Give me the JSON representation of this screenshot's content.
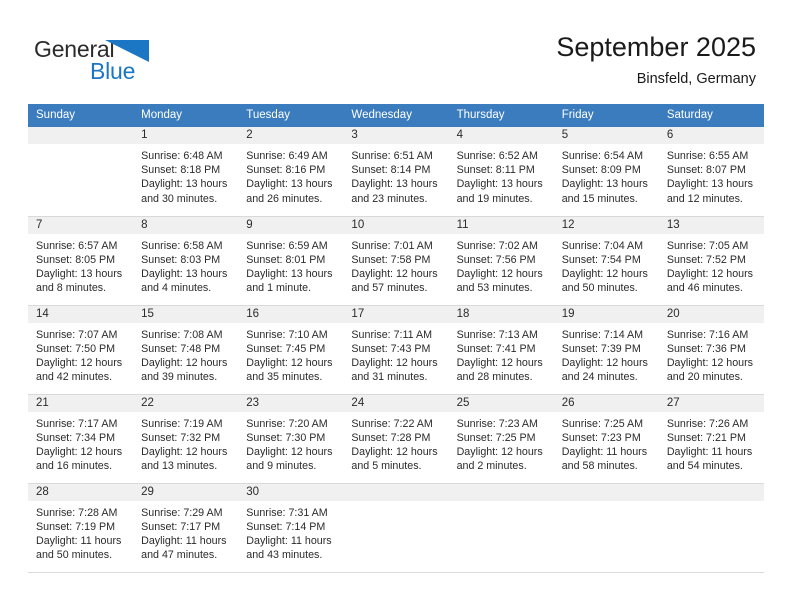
{
  "brand": {
    "name_part1": "General",
    "name_part2": "Blue",
    "accent_color": "#1b76c4",
    "triangle_icon": "triangle-right-icon"
  },
  "header": {
    "title": "September 2025",
    "subtitle": "Binsfeld, Germany",
    "header_bg": "#3b7cbf"
  },
  "calendar": {
    "weekday_headers": [
      "Sunday",
      "Monday",
      "Tuesday",
      "Wednesday",
      "Thursday",
      "Friday",
      "Saturday"
    ],
    "weeks": [
      [
        {
          "day": "",
          "sunrise": "",
          "sunset": "",
          "daylight1": "",
          "daylight2": "",
          "blank": true
        },
        {
          "day": "1",
          "sunrise": "Sunrise: 6:48 AM",
          "sunset": "Sunset: 8:18 PM",
          "daylight1": "Daylight: 13 hours",
          "daylight2": "and 30 minutes."
        },
        {
          "day": "2",
          "sunrise": "Sunrise: 6:49 AM",
          "sunset": "Sunset: 8:16 PM",
          "daylight1": "Daylight: 13 hours",
          "daylight2": "and 26 minutes."
        },
        {
          "day": "3",
          "sunrise": "Sunrise: 6:51 AM",
          "sunset": "Sunset: 8:14 PM",
          "daylight1": "Daylight: 13 hours",
          "daylight2": "and 23 minutes."
        },
        {
          "day": "4",
          "sunrise": "Sunrise: 6:52 AM",
          "sunset": "Sunset: 8:11 PM",
          "daylight1": "Daylight: 13 hours",
          "daylight2": "and 19 minutes."
        },
        {
          "day": "5",
          "sunrise": "Sunrise: 6:54 AM",
          "sunset": "Sunset: 8:09 PM",
          "daylight1": "Daylight: 13 hours",
          "daylight2": "and 15 minutes."
        },
        {
          "day": "6",
          "sunrise": "Sunrise: 6:55 AM",
          "sunset": "Sunset: 8:07 PM",
          "daylight1": "Daylight: 13 hours",
          "daylight2": "and 12 minutes."
        }
      ],
      [
        {
          "day": "7",
          "sunrise": "Sunrise: 6:57 AM",
          "sunset": "Sunset: 8:05 PM",
          "daylight1": "Daylight: 13 hours",
          "daylight2": "and 8 minutes."
        },
        {
          "day": "8",
          "sunrise": "Sunrise: 6:58 AM",
          "sunset": "Sunset: 8:03 PM",
          "daylight1": "Daylight: 13 hours",
          "daylight2": "and 4 minutes."
        },
        {
          "day": "9",
          "sunrise": "Sunrise: 6:59 AM",
          "sunset": "Sunset: 8:01 PM",
          "daylight1": "Daylight: 13 hours",
          "daylight2": "and 1 minute."
        },
        {
          "day": "10",
          "sunrise": "Sunrise: 7:01 AM",
          "sunset": "Sunset: 7:58 PM",
          "daylight1": "Daylight: 12 hours",
          "daylight2": "and 57 minutes."
        },
        {
          "day": "11",
          "sunrise": "Sunrise: 7:02 AM",
          "sunset": "Sunset: 7:56 PM",
          "daylight1": "Daylight: 12 hours",
          "daylight2": "and 53 minutes."
        },
        {
          "day": "12",
          "sunrise": "Sunrise: 7:04 AM",
          "sunset": "Sunset: 7:54 PM",
          "daylight1": "Daylight: 12 hours",
          "daylight2": "and 50 minutes."
        },
        {
          "day": "13",
          "sunrise": "Sunrise: 7:05 AM",
          "sunset": "Sunset: 7:52 PM",
          "daylight1": "Daylight: 12 hours",
          "daylight2": "and 46 minutes."
        }
      ],
      [
        {
          "day": "14",
          "sunrise": "Sunrise: 7:07 AM",
          "sunset": "Sunset: 7:50 PM",
          "daylight1": "Daylight: 12 hours",
          "daylight2": "and 42 minutes."
        },
        {
          "day": "15",
          "sunrise": "Sunrise: 7:08 AM",
          "sunset": "Sunset: 7:48 PM",
          "daylight1": "Daylight: 12 hours",
          "daylight2": "and 39 minutes."
        },
        {
          "day": "16",
          "sunrise": "Sunrise: 7:10 AM",
          "sunset": "Sunset: 7:45 PM",
          "daylight1": "Daylight: 12 hours",
          "daylight2": "and 35 minutes."
        },
        {
          "day": "17",
          "sunrise": "Sunrise: 7:11 AM",
          "sunset": "Sunset: 7:43 PM",
          "daylight1": "Daylight: 12 hours",
          "daylight2": "and 31 minutes."
        },
        {
          "day": "18",
          "sunrise": "Sunrise: 7:13 AM",
          "sunset": "Sunset: 7:41 PM",
          "daylight1": "Daylight: 12 hours",
          "daylight2": "and 28 minutes."
        },
        {
          "day": "19",
          "sunrise": "Sunrise: 7:14 AM",
          "sunset": "Sunset: 7:39 PM",
          "daylight1": "Daylight: 12 hours",
          "daylight2": "and 24 minutes."
        },
        {
          "day": "20",
          "sunrise": "Sunrise: 7:16 AM",
          "sunset": "Sunset: 7:36 PM",
          "daylight1": "Daylight: 12 hours",
          "daylight2": "and 20 minutes."
        }
      ],
      [
        {
          "day": "21",
          "sunrise": "Sunrise: 7:17 AM",
          "sunset": "Sunset: 7:34 PM",
          "daylight1": "Daylight: 12 hours",
          "daylight2": "and 16 minutes."
        },
        {
          "day": "22",
          "sunrise": "Sunrise: 7:19 AM",
          "sunset": "Sunset: 7:32 PM",
          "daylight1": "Daylight: 12 hours",
          "daylight2": "and 13 minutes."
        },
        {
          "day": "23",
          "sunrise": "Sunrise: 7:20 AM",
          "sunset": "Sunset: 7:30 PM",
          "daylight1": "Daylight: 12 hours",
          "daylight2": "and 9 minutes."
        },
        {
          "day": "24",
          "sunrise": "Sunrise: 7:22 AM",
          "sunset": "Sunset: 7:28 PM",
          "daylight1": "Daylight: 12 hours",
          "daylight2": "and 5 minutes."
        },
        {
          "day": "25",
          "sunrise": "Sunrise: 7:23 AM",
          "sunset": "Sunset: 7:25 PM",
          "daylight1": "Daylight: 12 hours",
          "daylight2": "and 2 minutes."
        },
        {
          "day": "26",
          "sunrise": "Sunrise: 7:25 AM",
          "sunset": "Sunset: 7:23 PM",
          "daylight1": "Daylight: 11 hours",
          "daylight2": "and 58 minutes."
        },
        {
          "day": "27",
          "sunrise": "Sunrise: 7:26 AM",
          "sunset": "Sunset: 7:21 PM",
          "daylight1": "Daylight: 11 hours",
          "daylight2": "and 54 minutes."
        }
      ],
      [
        {
          "day": "28",
          "sunrise": "Sunrise: 7:28 AM",
          "sunset": "Sunset: 7:19 PM",
          "daylight1": "Daylight: 11 hours",
          "daylight2": "and 50 minutes."
        },
        {
          "day": "29",
          "sunrise": "Sunrise: 7:29 AM",
          "sunset": "Sunset: 7:17 PM",
          "daylight1": "Daylight: 11 hours",
          "daylight2": "and 47 minutes."
        },
        {
          "day": "30",
          "sunrise": "Sunrise: 7:31 AM",
          "sunset": "Sunset: 7:14 PM",
          "daylight1": "Daylight: 11 hours",
          "daylight2": "and 43 minutes."
        },
        {
          "day": "",
          "sunrise": "",
          "sunset": "",
          "daylight1": "",
          "daylight2": "",
          "blank": true
        },
        {
          "day": "",
          "sunrise": "",
          "sunset": "",
          "daylight1": "",
          "daylight2": "",
          "blank": true
        },
        {
          "day": "",
          "sunrise": "",
          "sunset": "",
          "daylight1": "",
          "daylight2": "",
          "blank": true
        },
        {
          "day": "",
          "sunrise": "",
          "sunset": "",
          "daylight1": "",
          "daylight2": "",
          "blank": true
        }
      ]
    ]
  }
}
